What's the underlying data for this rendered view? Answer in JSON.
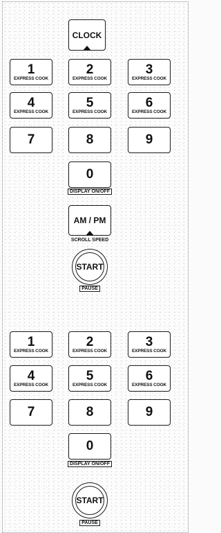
{
  "clock_label": "CLOCK",
  "express": "EXPRESS COOK",
  "keys": {
    "k1": "1",
    "k2": "2",
    "k3": "3",
    "k4": "4",
    "k5": "5",
    "k6": "6",
    "k7": "7",
    "k8": "8",
    "k9": "9",
    "k0": "0"
  },
  "display_caption": "DISPLAY ON/OFF",
  "ampm_label": "AM / PM",
  "scroll_caption": "SCROLL SPEED",
  "start_label": "START",
  "pause_caption": "PAUSE"
}
